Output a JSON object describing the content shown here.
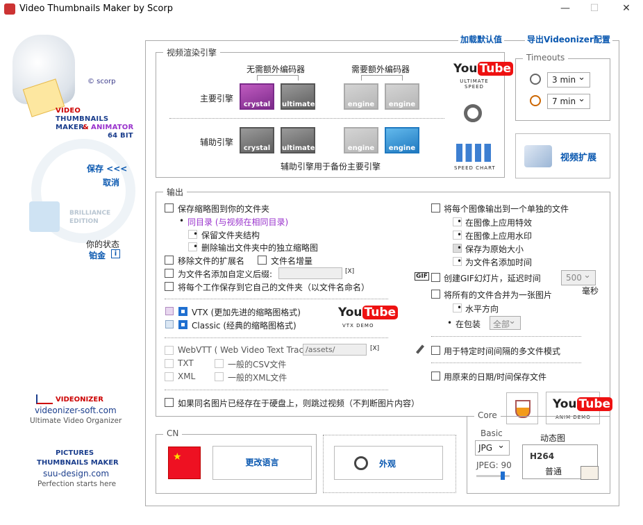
{
  "window": {
    "title": "Video Thumbnails Maker by Scorp",
    "min": "—",
    "max": "☐",
    "close": "✕"
  },
  "left": {
    "copyright": "© scorp",
    "brand_lines": [
      "VIDEO",
      "THUMBNAILS",
      "MAKER",
      "&",
      "ANIMATOR",
      "64 BIT"
    ],
    "save": "保存 <<<",
    "cancel": "取消",
    "brilliance": [
      "BRILLIANCE",
      "EDITION"
    ],
    "status_label": "你的状态",
    "status_value": "铂金",
    "info_icon": "i",
    "videonizer": {
      "name": "VIDEONIZER",
      "site": "videonizer-soft.com",
      "tagline": "Ultimate Video Organizer"
    },
    "pictures": {
      "name1": "PICTURES",
      "name2": "THUMBNAILS MAKER",
      "site": "suu-design.com",
      "tagline": "Perfection starts here"
    }
  },
  "top_links": {
    "load_defaults": "加载默认值",
    "export_videonizer": "导出Videonizer配置"
  },
  "render": {
    "group_title": "视频渲染引擎",
    "col_no_codec": "无需额外编码器",
    "col_need_codec": "需要额外编码器",
    "row_main": "主要引擎",
    "row_aux": "辅助引擎",
    "note": "辅助引擎用于备份主要引擎",
    "main": [
      "crystal",
      "ultimate",
      "engine 1",
      "engine 2"
    ],
    "aux": [
      "crystal",
      "ultimate",
      "engine 1",
      "engine 2"
    ],
    "yt_you": "You",
    "yt_tube": "Tube",
    "ultimate_speed": [
      "ULTIMATE",
      "SPEED"
    ],
    "speed_chart": "SPEED CHART"
  },
  "timeouts": {
    "title": "Timeouts",
    "t1": "3 min",
    "t2": "7 min"
  },
  "video_ext": "视频扩展",
  "output": {
    "group_title": "输出",
    "save_to_folder": "保存缩略图到你的文件夹",
    "same_dir": "同目录 (与视频在相同目录)",
    "keep_structure": "保留文件夹结构",
    "delete_orphans": "删除输出文件夹中的独立缩略图",
    "remove_ext": "移除文件的扩展名",
    "filename_inc": "文件名增量",
    "add_suffix": "为文件名添加自定义后缀:",
    "x1": "[X]",
    "save_each_job": "将每个工作保存到它自己的文件夹（以文件名命名）",
    "vtx": "VTX (更加先进的缩略图格式)",
    "classic": "Classic (经典的缩略图格式)",
    "vtx_demo": "VTX DEMO",
    "webvtt": "WebVTT ( Web Video Text Tracks ):",
    "assets": "/assets/",
    "x2": "[X]",
    "txt": "TXT",
    "csv": "一般的CSV文件",
    "xml": "XML",
    "gxml": "一般的XML文件",
    "skip": "如果同名图片已经存在于硬盘上，则跳过视频（不判断图片内容）",
    "each_image": "将每个图像输出到一个单独的文件",
    "apply_fx": "在图像上应用特效",
    "apply_wm": "在图像上应用水印",
    "orig_size": "保存为原始大小",
    "add_time": "为文件名添加时间",
    "gif_badge": "GIF",
    "gif": "创建GIF幻灯片，延迟时间",
    "gif_delay": "500",
    "ms": "毫秒",
    "merge": "将所有的文件合并为一张图片",
    "horizontal": "水平方向",
    "in_pack": "在包装",
    "all": "全部",
    "multi_file": "用于特定时间间隔的多文件模式",
    "orig_date": "用原来的日期/时间保存文件",
    "anim_demo": "ANIM DEMO"
  },
  "lang": {
    "title": "CN",
    "change": "更改语言"
  },
  "appearance": "外观",
  "core": {
    "title": "Core",
    "basic": "Basic",
    "format": "JPG",
    "jpeg": "JPEG: 90",
    "anim": "动态图",
    "codec": "H264",
    "quality": "普通"
  }
}
